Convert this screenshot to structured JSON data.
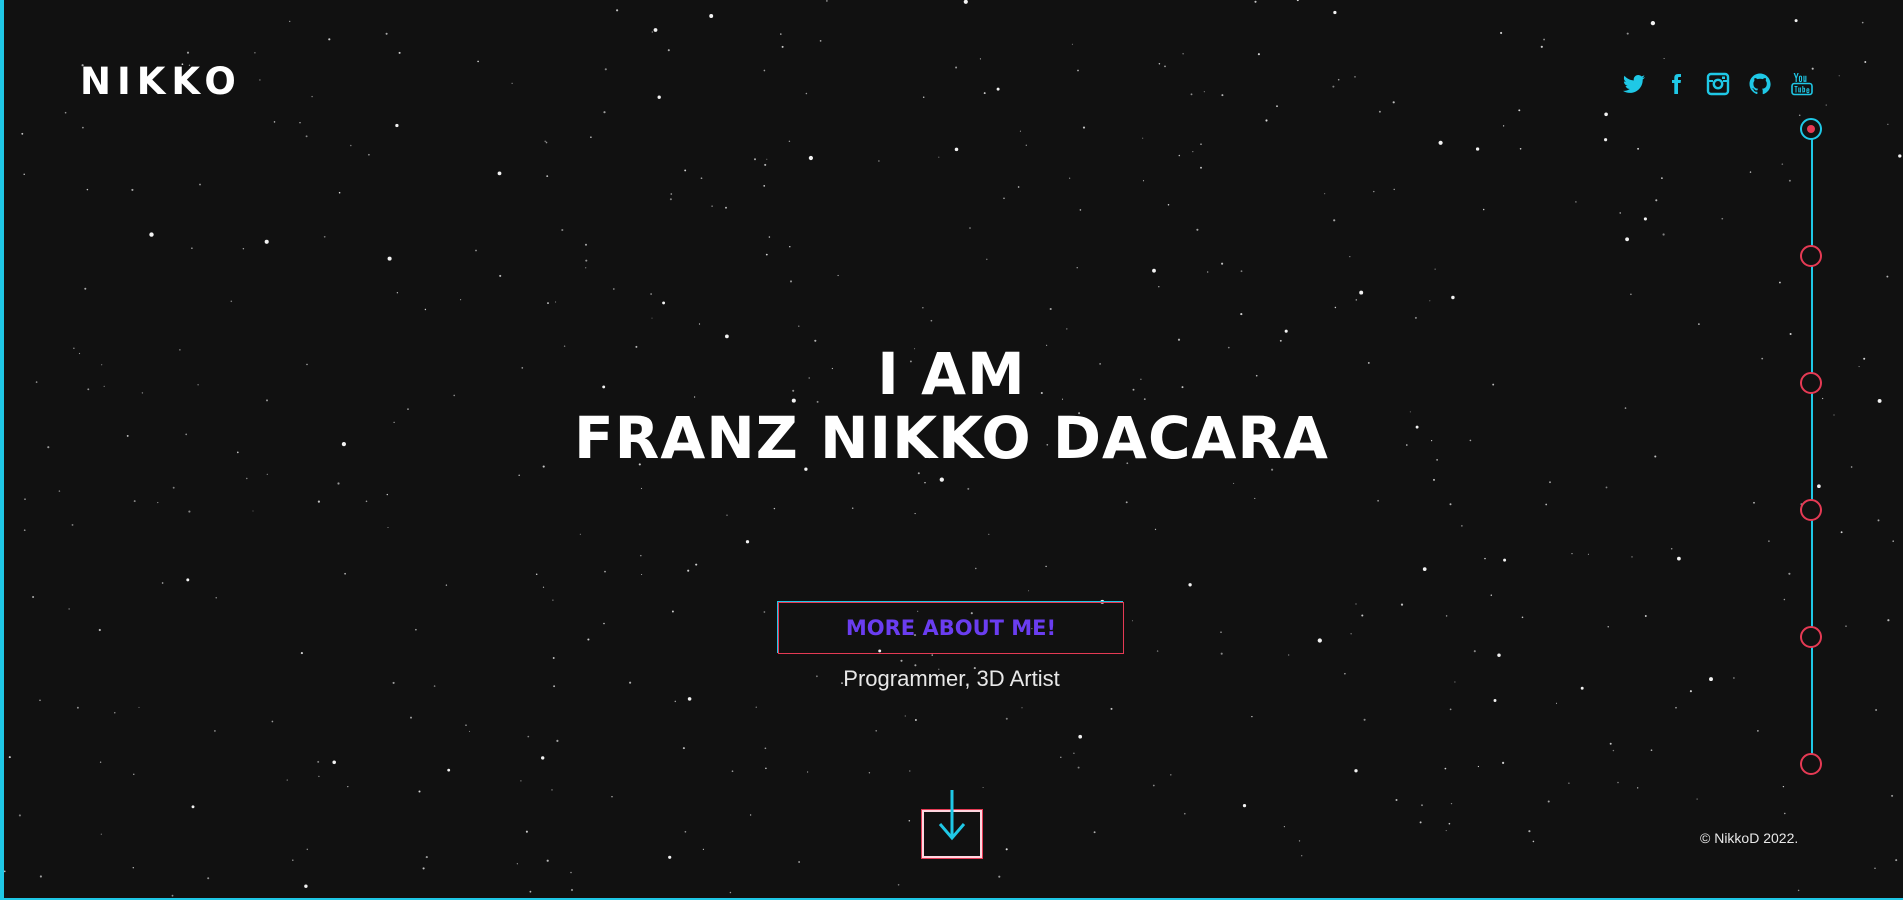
{
  "brand": {
    "logo": "NIKKO"
  },
  "socials": [
    {
      "name": "twitter-icon"
    },
    {
      "name": "facebook-icon"
    },
    {
      "name": "instagram-icon"
    },
    {
      "name": "github-icon"
    },
    {
      "name": "youtube-icon"
    }
  ],
  "hero": {
    "line1": "I AM",
    "line2": "FRANZ NIKKO DACARA",
    "cta_label": "MORE ABOUT ME!",
    "subtitle": "Programmer, 3D Artist"
  },
  "scroll": {
    "icon": "arrow-down-icon"
  },
  "timeline": {
    "active_index": 0,
    "count": 6
  },
  "footer": {
    "copyright": "© NikkoD 2022."
  },
  "colors": {
    "background": "#111111",
    "accent_cyan": "#1fc8e6",
    "accent_red": "#e53a54",
    "cta_text": "#6a3df0",
    "text": "#ffffff"
  }
}
